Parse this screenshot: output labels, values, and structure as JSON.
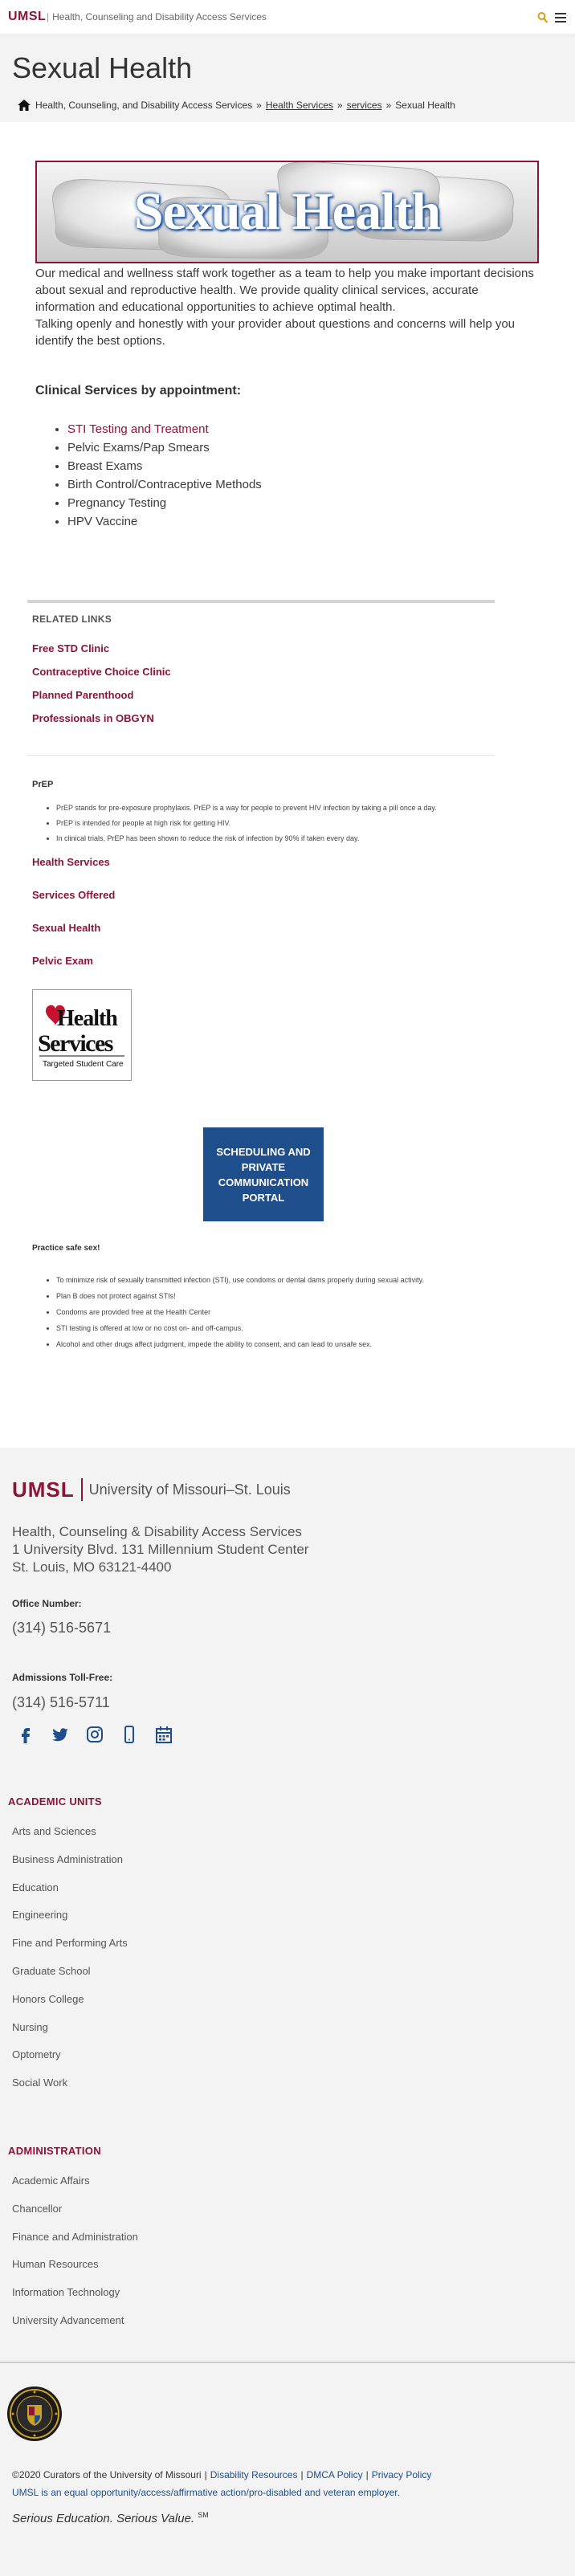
{
  "header": {
    "brand": "UMSL",
    "sitename": "Health, Counseling and Disability Access Services",
    "separator": "|"
  },
  "page": {
    "title": "Sexual Health",
    "breadcrumb": {
      "home": "Health, Counseling, and Disability Access Services",
      "items": [
        "Health Services",
        "services"
      ],
      "current": "Sexual Health",
      "separator": "»"
    }
  },
  "hero": {
    "text": "Sexual Health"
  },
  "intro": {
    "p1": "Our medical and wellness staff work together as a team to help you make important decisions about sexual and reproductive health. We provide quality clinical services, accurate information and educational opportunities to achieve optimal health.",
    "p2": "Talking openly and honestly with your provider about questions and concerns will help you identify the best options."
  },
  "services": {
    "heading": "Clinical Services by appointment:",
    "items": [
      "STI Testing and Treatment",
      "Pelvic Exams/Pap Smears",
      "Breast Exams",
      "Birth Control/Contraceptive Methods",
      "Pregnancy Testing",
      "HPV Vaccine"
    ]
  },
  "related": {
    "heading": "RELATED LINKS",
    "links": [
      "Free STD Clinic",
      "Contraceptive Choice Clinic",
      "Planned Parenthood",
      "Professionals in OBGYN"
    ]
  },
  "prep": {
    "heading": "PrEP",
    "bullets": [
      "PrEP stands for pre-exposure prophylaxis. PrEP is a way for people to prevent HIV infection by taking a pill once a day.",
      "PrEP is intended for people at high risk for getting HIV.",
      "In clinical trials, PrEP has been shown to reduce the risk of infection by 90% if taken every day."
    ],
    "links": [
      "Health Services",
      "Services Offered",
      "Sexual Health",
      "Pelvic Exam"
    ]
  },
  "hs_logo": {
    "line1": "Health",
    "line2": "Services",
    "tagline": "Targeted Student Care"
  },
  "portal": {
    "label": "SCHEDULING AND PRIVATE COMMUNICATION PORTAL"
  },
  "safe": {
    "heading": "Practice safe sex!",
    "bullets": [
      "To minimize risk of sexually transmitted infection (STI), use condoms or dental dams properly during sexual activity.",
      "Plan B does not protect against STIs!",
      "Condoms are provided free at the Health Center",
      "STI testing is offered at low or no cost on- and off-campus.",
      "Alcohol and other drugs affect judgment, impede the ability to consent, and can lead to unsafe sex."
    ]
  },
  "footer": {
    "logo_mark": "UMSL",
    "logo_text": "University of Missouri–St. Louis",
    "dept": "Health, Counseling & Disability Access Services",
    "address1": "1 University Blvd. 131 Millennium Student Center",
    "address2": "St. Louis, MO 63121-4400",
    "office_label": "Office Number:",
    "office_phone": "(314) 516-5671",
    "admissions_label": "Admissions Toll-Free:",
    "admissions_phone": "(314) 516-5711",
    "social": [
      "facebook-icon",
      "twitter-icon",
      "instagram-icon",
      "mobile-icon",
      "calendar-icon"
    ],
    "academic_heading": "ACADEMIC UNITS",
    "academic_units": [
      "Arts and Sciences",
      "Business Administration",
      "Education",
      "Engineering",
      "Fine and Performing Arts",
      "Graduate School",
      "Honors College",
      "Nursing",
      "Optometry",
      "Social Work"
    ],
    "admin_heading": "ADMINISTRATION",
    "admin_units": [
      "Academic Affairs",
      "Chancellor",
      "Finance and Administration",
      "Human Resources",
      "Information Technology",
      "University Advancement"
    ],
    "copyright": "©2020 Curators of the University of Missouri",
    "legal_links": [
      "Disability Resources",
      "DMCA Policy",
      "Privacy Policy"
    ],
    "eeo": "UMSL is an equal opportunity/access/affirmative action/pro-disabled and veteran employer.",
    "tagline": "Serious Education. Serious Value.",
    "tagline_mark": "SM"
  },
  "colors": {
    "brand": "#8a1538",
    "link_blue": "#1f4e8c",
    "footer_bg": "#f3f3f3"
  }
}
